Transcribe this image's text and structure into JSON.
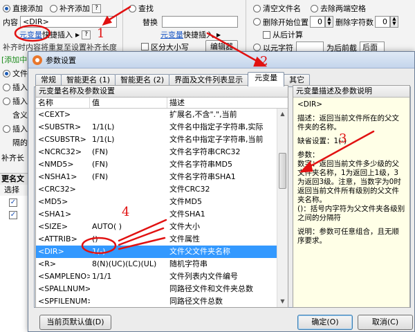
{
  "background": {
    "row1": {
      "radio1": "直接添加",
      "radio2": "补齐添加",
      "find_label": "查找",
      "clear_ext": "清空文件名",
      "trim": "去除两端空格"
    },
    "row2": {
      "content_label": "内容",
      "content_value": "<DIR>",
      "replace_label": "替换",
      "delete_start": "删除开始位置",
      "delete_start_value": "0",
      "delete_count": "删除字符数",
      "delete_count_value": "0"
    },
    "row3": {
      "var_link": "元变量",
      "quick_insert": "快捷插入",
      "var_link2": "元变量",
      "quick_insert2": "快捷插入",
      "calc_from_end": "从后计算"
    },
    "row4": {
      "pad_text": "补齐时内容将重复至设置补齐长度",
      "case_sensitive": "区分大小写",
      "editor_button": "编辑器",
      "var_label": "以元字符",
      "prefix_label": "为后前截",
      "after_label": "后面"
    },
    "left_strip": [
      "[添加中",
      "文件",
      "插入",
      "插入",
      "含义",
      "插入",
      "隔的",
      "补齐长"
    ],
    "left_bottom": {
      "header": "更名文",
      "select": "选择"
    }
  },
  "dialog": {
    "title": "参数设置",
    "tabs": [
      "常规",
      "智能更名 (1)",
      "智能更名 (2)",
      "界面及文件列表显示",
      "元变量",
      "其它"
    ],
    "active_tab": 4,
    "left_panel": {
      "title": "元变量名称及参数设置",
      "columns": [
        "名称",
        "值",
        "描述"
      ],
      "rows": [
        {
          "name": "<CEXT>",
          "value": "",
          "desc": "扩展名,不含\".\",当前"
        },
        {
          "name": "<SUBSTR>",
          "value": "1/1(L)",
          "desc": "文件名中指定子字符串,实际"
        },
        {
          "name": "<CSUBSTR>",
          "value": "1/1(L)",
          "desc": "文件名中指定子字符串,当前"
        },
        {
          "name": "<NCRC32>",
          "value": "(FN)",
          "desc": "文件名字符串CRC32"
        },
        {
          "name": "<NMD5>",
          "value": "(FN)",
          "desc": "文件名字符串MD5"
        },
        {
          "name": "<NSHA1>",
          "value": "(FN)",
          "desc": "文件名字符串SHA1"
        },
        {
          "name": "<CRC32>",
          "value": "",
          "desc": "文件CRC32"
        },
        {
          "name": "<MD5>",
          "value": "",
          "desc": "文件MD5"
        },
        {
          "name": "<SHA1>",
          "value": "",
          "desc": "文件SHA1"
        },
        {
          "name": "<SIZE>",
          "value": "AUTO( )",
          "desc": "文件大小"
        },
        {
          "name": "<ATTRIB>",
          "value": "()",
          "desc": "文件属性"
        },
        {
          "name": "<DIR>",
          "value": "1(-)",
          "desc": "文件父文件夹名称"
        },
        {
          "name": "<R>",
          "value": "8(N)(UC)(LC)(UL)",
          "desc": "随机字符串"
        },
        {
          "name": "<SAMPLENO>",
          "value": "1/1/1",
          "desc": "文件列表内文件编号"
        },
        {
          "name": "<SPALLNUM>",
          "value": "",
          "desc": "同路径文件和文件夹总数"
        },
        {
          "name": "<SPFILENUM>",
          "value": "",
          "desc": "同路径文件总数"
        }
      ],
      "selected_row": 11
    },
    "right_panel": {
      "title": "元变量描述及参数说明",
      "name": "<DIR>",
      "desc": "描述：返回当前文件所在的父文件夹的名称。",
      "default": "缺省设置：1(-)",
      "params": "参数：\n数字：返回当前文件多少级的父文件夹名称，1为返回上1级，3为返回3级。注意，当数字为0时返回当前文件所有级别的父文件夹名称。\n()：括号内字符为父文件夹各级别之间的分隔符",
      "note": "说明：参数可任意组合，且无顺序要求。"
    },
    "buttons": {
      "reset": "当前页默认值(D)",
      "ok": "确定(O)",
      "cancel": "取消(C)"
    }
  },
  "annotations": [
    "1",
    "2",
    "3",
    "4"
  ],
  "colors": {
    "annotation": "#e11111",
    "selection": "#3399ff",
    "link": "#1a57c6"
  }
}
